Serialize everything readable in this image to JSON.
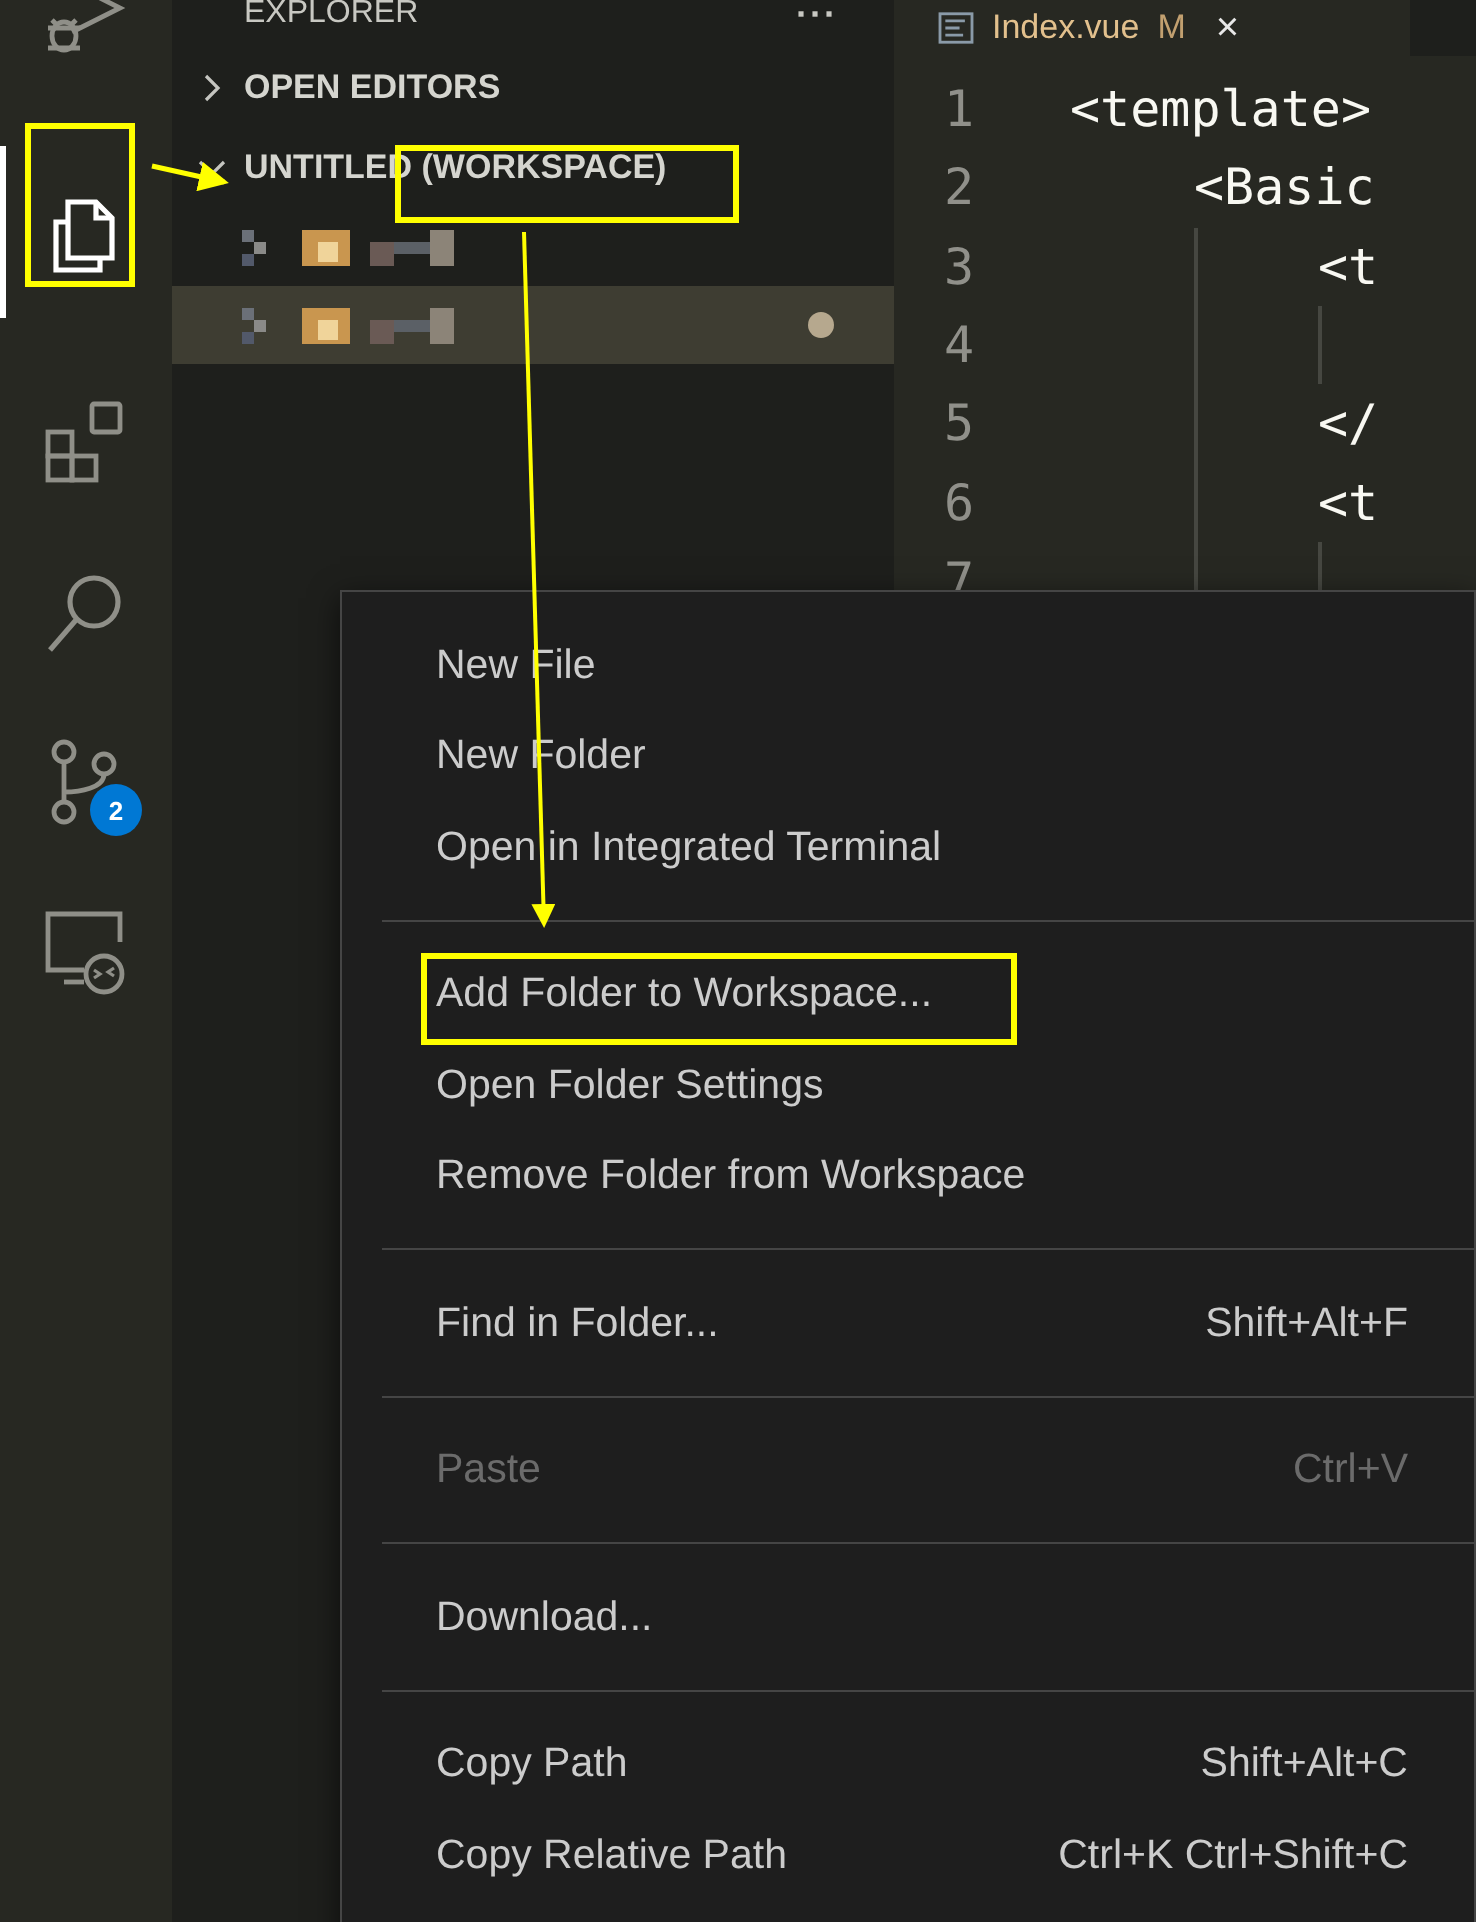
{
  "activity_bar": {
    "items": [
      {
        "kind": "debug",
        "selected": false
      },
      {
        "kind": "explorer",
        "selected": true
      },
      {
        "kind": "extensions",
        "selected": false
      },
      {
        "kind": "search",
        "selected": false
      },
      {
        "kind": "git",
        "selected": false,
        "badge": "2"
      },
      {
        "kind": "remote",
        "selected": false
      }
    ]
  },
  "sidebar": {
    "title": "EXPLORER",
    "more": "···",
    "sections": [
      {
        "label": "OPEN EDITORS",
        "expanded": false
      },
      {
        "label": "UNTITLED (WORKSPACE)",
        "expanded": true
      }
    ],
    "folders": [
      {
        "selected": false,
        "modified": false
      },
      {
        "selected": true,
        "modified": true
      }
    ]
  },
  "editor": {
    "tab": {
      "file_name": "Index.vue",
      "badge": "M",
      "close": "×",
      "selected": true
    },
    "lines": [
      {
        "number": "1",
        "code": "<template>",
        "children": [
          {
            "number": "2",
            "code": "<Basic",
            "children": [
              {
                "number": "3",
                "code": "<t",
                "children": [
                  {
                    "number": "4"
                  }
                ]
              },
              {
                "number": "5",
                "code": "</"
              },
              {
                "number": "6",
                "code": "<t",
                "children": [
                  {
                    "number": "7"
                  }
                ]
              }
            ]
          }
        ]
      }
    ]
  },
  "context_menu": {
    "groups": [
      [
        {
          "label": "New File",
          "disabled": false
        },
        {
          "label": "New Folder",
          "disabled": false
        },
        {
          "label": "Open in Integrated Terminal",
          "disabled": false
        }
      ],
      [
        {
          "label": "Add Folder to Workspace...",
          "disabled": false
        },
        {
          "label": "Open Folder Settings",
          "disabled": false
        },
        {
          "label": "Remove Folder from Workspace",
          "disabled": false
        }
      ],
      [
        {
          "label": "Find in Folder...",
          "shortcut": "Shift+Alt+F",
          "disabled": false
        }
      ],
      [
        {
          "label": "Paste",
          "shortcut": "Ctrl+V",
          "disabled": true
        }
      ],
      [
        {
          "label": "Download...",
          "disabled": false
        }
      ],
      [
        {
          "label": "Copy Path",
          "shortcut": "Shift+Alt+C",
          "disabled": false
        },
        {
          "label": "Copy Relative Path",
          "shortcut": "Ctrl+K Ctrl+Shift+C",
          "disabled": false
        }
      ]
    ]
  }
}
